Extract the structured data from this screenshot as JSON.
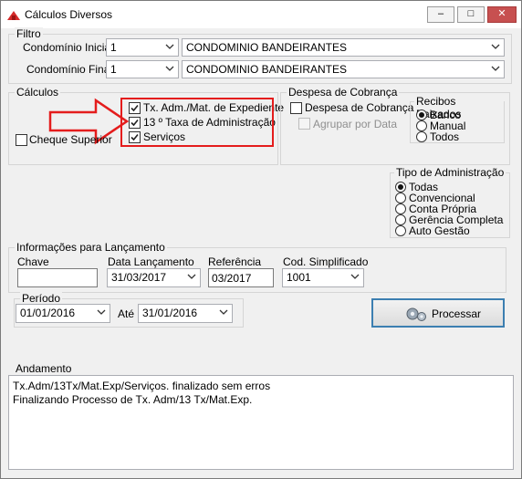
{
  "window": {
    "title": "Cálculos Diversos",
    "controls": {
      "minimize": "–",
      "maximize": "□",
      "close": "✕"
    }
  },
  "filtro": {
    "group_label": "Filtro",
    "condominio_inicial": {
      "label": "Condomínio Inicial",
      "code": "1",
      "name": "CONDOMINIO BANDEIRANTES"
    },
    "condominio_final": {
      "label": "Condomínio Final",
      "code": "1",
      "name": "CONDOMINIO BANDEIRANTES"
    }
  },
  "calculos": {
    "group_label": "Cálculos",
    "cheque_superior": {
      "label": "Cheque Superior",
      "checked": false
    },
    "items": [
      {
        "label": "Tx. Adm./Mat. de Expediente",
        "checked": true
      },
      {
        "label": "13 º Taxa de Administração",
        "checked": true
      },
      {
        "label": "Serviços",
        "checked": true
      }
    ]
  },
  "despesa": {
    "group_label": "Despesa de Cobrança",
    "despesa_cobranca": {
      "label": "Despesa de Cobrança",
      "checked": false
    },
    "agrupar_por_data": {
      "label": "Agrupar por Data",
      "checked": false,
      "enabled": false
    }
  },
  "recibos": {
    "group_label": "Recibos Baixados",
    "options": [
      "Banco",
      "Manual",
      "Todos"
    ],
    "selected": "Banco"
  },
  "tipo_admin": {
    "group_label": "Tipo de Administração",
    "options": [
      "Todas",
      "Convencional",
      "Conta Própria",
      "Gerência Completa",
      "Auto Gestão"
    ],
    "selected": "Todas"
  },
  "lancamento": {
    "group_label": "Informações para Lançamento",
    "chave": {
      "label": "Chave",
      "value": ""
    },
    "data_lancamento": {
      "label": "Data Lançamento",
      "value": "31/03/2017"
    },
    "referencia": {
      "label": "Referência",
      "value": "03/2017"
    },
    "cod_simplificado": {
      "label": "Cod. Simplificado",
      "value": "1001"
    }
  },
  "periodo": {
    "group_label": "Período",
    "inicio": "01/01/2016",
    "ate_label": "Até",
    "fim": "31/01/2016"
  },
  "processar": {
    "label": "Processar"
  },
  "andamento": {
    "group_label": "Andamento",
    "lines": [
      "Tx.Adm/13Tx/Mat.Exp/Serviços. finalizado sem erros",
      "Finalizando Processo de Tx. Adm/13 Tx/Mat.Exp."
    ]
  },
  "colors": {
    "annotation_red": "#e41c1c",
    "focus_blue": "#3c7fb1"
  }
}
